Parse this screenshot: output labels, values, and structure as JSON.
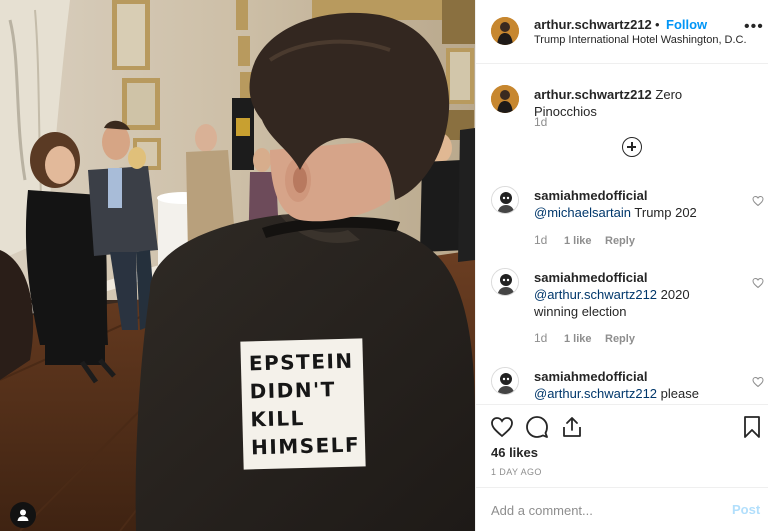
{
  "photo": {
    "patch_lines": [
      "EPSTEIN",
      "DIDN'T",
      "KILL",
      "HIMSELF"
    ]
  },
  "header": {
    "username": "arthur.schwartz212",
    "separator": "•",
    "follow_label": "Follow",
    "location": "Trump International Hotel Washington, D.C.",
    "more_icon": "ellipsis-icon"
  },
  "caption": {
    "username": "arthur.schwartz212",
    "text": "Zero Pinocchios",
    "time": "1d"
  },
  "comments": [
    {
      "username": "samiahmedofficial",
      "mention": "@michaelsartain",
      "text": "Trump 202",
      "time": "1d",
      "likes": "1 like",
      "reply_label": "Reply"
    },
    {
      "username": "samiahmedofficial",
      "mention": "@arthur.schwartz212",
      "text": "2020 winning election",
      "time": "1d",
      "likes": "1 like",
      "reply_label": "Reply"
    },
    {
      "username": "samiahmedofficial",
      "mention": "@arthur.schwartz212",
      "text": "please",
      "time": "",
      "likes": "",
      "reply_label": ""
    }
  ],
  "actions": {
    "likes": "46 likes",
    "date": "1 DAY AGO"
  },
  "add_comment": {
    "placeholder": "Add a comment...",
    "post_label": "Post"
  },
  "colors": {
    "link_blue": "#0095f6",
    "mention_blue": "#00376b",
    "muted_gray": "#8e8e8e",
    "post_disabled": "#b2dffc"
  }
}
